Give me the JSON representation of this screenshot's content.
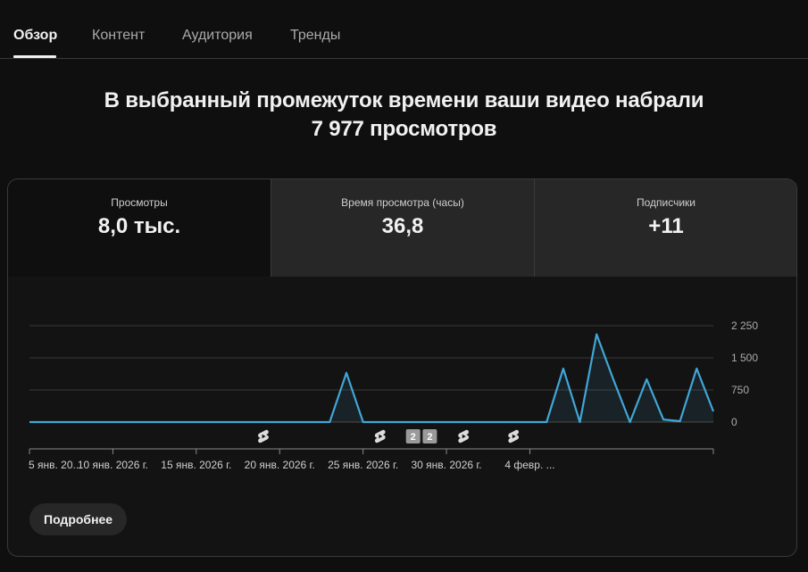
{
  "tabs": [
    {
      "label": "Обзор",
      "active": true
    },
    {
      "label": "Контент",
      "active": false
    },
    {
      "label": "Аудитория",
      "active": false
    },
    {
      "label": "Тренды",
      "active": false
    }
  ],
  "headline": {
    "line1": "В выбранный промежуток времени ваши видео набрали",
    "line2": "7 977 просмотров"
  },
  "metrics": [
    {
      "label": "Просмотры",
      "value": "8,0 тыс.",
      "selected": true
    },
    {
      "label": "Время просмотра (часы)",
      "value": "36,8",
      "selected": false
    },
    {
      "label": "Подписчики",
      "value": "+11",
      "selected": false
    }
  ],
  "chart_data": {
    "type": "area",
    "series": [
      {
        "values": [
          0,
          0,
          0,
          0,
          0,
          0,
          0,
          0,
          0,
          0,
          0,
          0,
          0,
          0,
          0,
          0,
          0,
          0,
          0,
          1150,
          0,
          0,
          0,
          0,
          0,
          0,
          0,
          0,
          0,
          0,
          0,
          0,
          1250,
          0,
          2050,
          1000,
          0,
          1000,
          60,
          20,
          1250,
          250
        ]
      }
    ],
    "x_start": "5 янв. 2026 г.",
    "ylim": [
      0,
      2250
    ],
    "yticks": [
      "2 250",
      "1 500",
      "750",
      "0"
    ],
    "ytick_values": [
      2250,
      1500,
      750,
      0
    ],
    "xtick_labels": [
      "5 янв. 20...",
      "10 янв. 2026 г.",
      "15 янв. 2026 г.",
      "20 янв. 2026 г.",
      "25 янв. 2026 г.",
      "30 янв. 2026 г.",
      "4 февр. ..."
    ],
    "xtick_index": [
      0,
      5,
      10,
      15,
      20,
      25,
      30
    ],
    "markers": [
      {
        "index": 14,
        "kind": "shorts-icon"
      },
      {
        "index": 21,
        "kind": "shorts-icon"
      },
      {
        "index": 23,
        "kind": "badge",
        "text": "2"
      },
      {
        "index": 24,
        "kind": "badge",
        "text": "2"
      },
      {
        "index": 26,
        "kind": "shorts-icon"
      },
      {
        "index": 29,
        "kind": "shorts-icon"
      }
    ],
    "line_color": "#41a6d6",
    "grid": true
  },
  "more_button": "Подробнее"
}
